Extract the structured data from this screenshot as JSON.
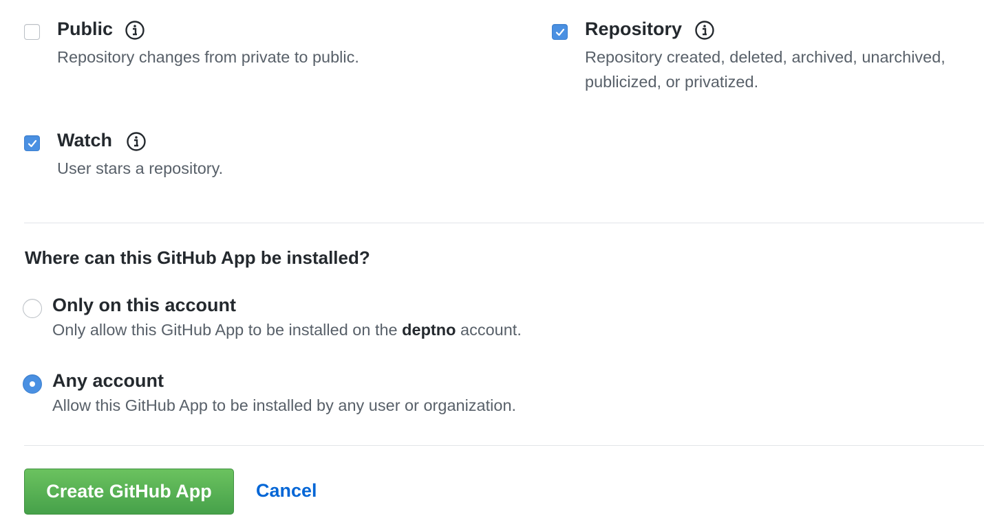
{
  "events": [
    {
      "id": "public",
      "label": "Public",
      "checked": false,
      "description": "Repository changes from private to public."
    },
    {
      "id": "repository",
      "label": "Repository",
      "checked": true,
      "description_line1": "Repository created, deleted, archived, unarchived,",
      "description_line2": "publicized, or privatized."
    },
    {
      "id": "watch",
      "label": "Watch",
      "checked": true,
      "description": "User stars a repository."
    }
  ],
  "install": {
    "heading": "Where can this GitHub App be installed?",
    "options": [
      {
        "label": "Only on this account",
        "description_prefix": "Only allow this GitHub App to be installed on the ",
        "description_account": "deptno",
        "description_suffix": " account.",
        "selected": false
      },
      {
        "label": "Any account",
        "description": "Allow this GitHub App to be installed by any user or organization.",
        "selected": true
      }
    ]
  },
  "actions": {
    "create_label": "Create GitHub App",
    "cancel_label": "Cancel"
  },
  "colors": {
    "checkbox_checked": "#4a90e2",
    "button_green": "#46a14a",
    "link_blue": "#0366d6"
  },
  "icons": {
    "info": "info-circle-icon",
    "check": "checkmark-icon"
  }
}
